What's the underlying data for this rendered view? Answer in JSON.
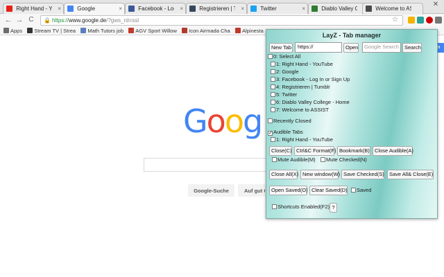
{
  "browser": {
    "tabs": [
      {
        "title": "Right Hand - Yo",
        "favicon_color": "#e62117",
        "active": false
      },
      {
        "title": "Google",
        "favicon_color": "#4285f4",
        "active": true
      },
      {
        "title": "Facebook - Log In",
        "favicon_color": "#3b5998",
        "active": false
      },
      {
        "title": "Registrieren | Tum",
        "favicon_color": "#36465d",
        "active": false
      },
      {
        "title": "Twitter",
        "favicon_color": "#1da1f2",
        "active": false
      },
      {
        "title": "Diablo Valley Colle",
        "favicon_color": "#2e7d32",
        "active": false
      },
      {
        "title": "Welcome to ASSIS",
        "favicon_color": "#4a4a4a",
        "active": false
      }
    ],
    "tab_close_glyph": "×",
    "window_controls": {
      "minimize": "—",
      "maximize": "▢",
      "close": "✕"
    },
    "nav": {
      "back": "←",
      "forward": "→",
      "reload": "C"
    },
    "url": {
      "lock": "🔒",
      "scheme": "https://",
      "host": "www.google.de",
      "rest": "/?gws_rd=ssl"
    },
    "star": "☆",
    "bookmarks": [
      {
        "label": "Apps",
        "icon_color": "#6d6d6d"
      },
      {
        "label": "Stream TV | Strea",
        "icon_color": "#333333"
      },
      {
        "label": "Math Tutors job",
        "icon_color": "#5b7fbd"
      },
      {
        "label": "AGV Sport Willow",
        "icon_color": "#c0392b"
      },
      {
        "label": "Icon Airmada Cha",
        "icon_color": "#b03a2e"
      },
      {
        "label": "Alpinesta",
        "icon_color": "#c0392b"
      }
    ]
  },
  "google": {
    "logo_letters": [
      {
        "ch": "G",
        "color": "#4285f4"
      },
      {
        "ch": "o",
        "color": "#ea4335"
      },
      {
        "ch": "o",
        "color": "#fbbc05"
      },
      {
        "ch": "g",
        "color": "#4285f4"
      }
    ],
    "search_button": "Google-Suche",
    "lucky_button": "Auf gut G",
    "signin_fragment": "m"
  },
  "popup": {
    "title": "LayZ - Tab manager",
    "new_tab": "New Tab",
    "url_value": "https://",
    "open": "Open",
    "google_search_placeholder": "Google Search",
    "search": "Search",
    "select_all": "0: Select All",
    "tab_list": [
      "1: Right Hand - YouTube",
      "2: Google",
      "3: Facebook - Log In or Sign Up",
      "4: Registrieren | Tumblr",
      "5: Twitter",
      "6: Diablo Valley College - Home",
      "7: Welcome to ASSIST"
    ],
    "recently_closed": "Recently Closed",
    "audible_tabs": "Audible Tabs",
    "audible_list": [
      "1: Right Hand - YouTube"
    ],
    "close_c": "Close(C)",
    "ctrl_format": "Ctrl&C Format(F)",
    "bookmark": "Bookmark(B)",
    "close_audible": "Close Audible(A)",
    "mute_audible": "Mute Audible(M)",
    "mute_checked": "Mute Checked(N)",
    "close_all": "Close All(X)",
    "new_window": "New window(W)",
    "save_checked": "Save Checked(S)",
    "save_all_close": "Save All& Close(E)",
    "open_saved": "Open Saved(O)",
    "clear_saved": "Clear Saved(D)",
    "saved": "Saved",
    "shortcuts": "Shortcuts Enabled(F2)",
    "help": "?"
  }
}
